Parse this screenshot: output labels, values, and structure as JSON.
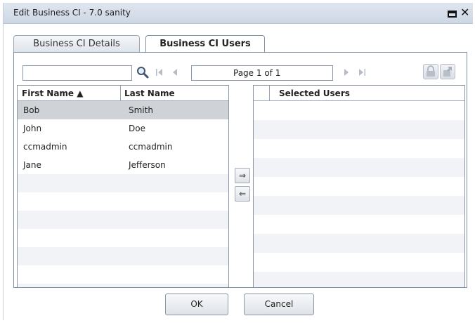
{
  "window": {
    "title": "Edit Business CI - 7.0 sanity"
  },
  "tabs": [
    {
      "label": "Business CI Details",
      "active": false
    },
    {
      "label": "Business CI Users",
      "active": true
    }
  ],
  "toolbar": {
    "search_value": "",
    "page_text": "Page 1 of 1"
  },
  "left_grid": {
    "columns": [
      "First Name ▲",
      "Last Name"
    ],
    "rows": [
      {
        "first": "Bob",
        "last": "Smith",
        "selected": true
      },
      {
        "first": "John",
        "last": "Doe"
      },
      {
        "first": "ccmadmin",
        "last": "ccmadmin"
      },
      {
        "first": "Jane",
        "last": "Jefferson"
      }
    ]
  },
  "right_grid": {
    "columns": [
      "Selected Users"
    ],
    "rows": []
  },
  "move": {
    "add_glyph": "⇒",
    "remove_glyph": "⇐"
  },
  "footer": {
    "ok_label": "OK",
    "cancel_label": "Cancel"
  },
  "icons": {
    "search": "magnifier-icon",
    "first_page": "first-page-icon",
    "prev_page": "prev-page-icon",
    "next_page": "next-page-icon",
    "last_page": "last-page-icon",
    "lock": "lock-icon",
    "export": "export-icon",
    "maximize": "maximize-icon",
    "close": "close-icon"
  },
  "colors": {
    "titlebar": "#d5dde8",
    "selected_row": "#cfd2d6",
    "alt_row": "#f1f3f6",
    "border": "#7d8ea4"
  }
}
